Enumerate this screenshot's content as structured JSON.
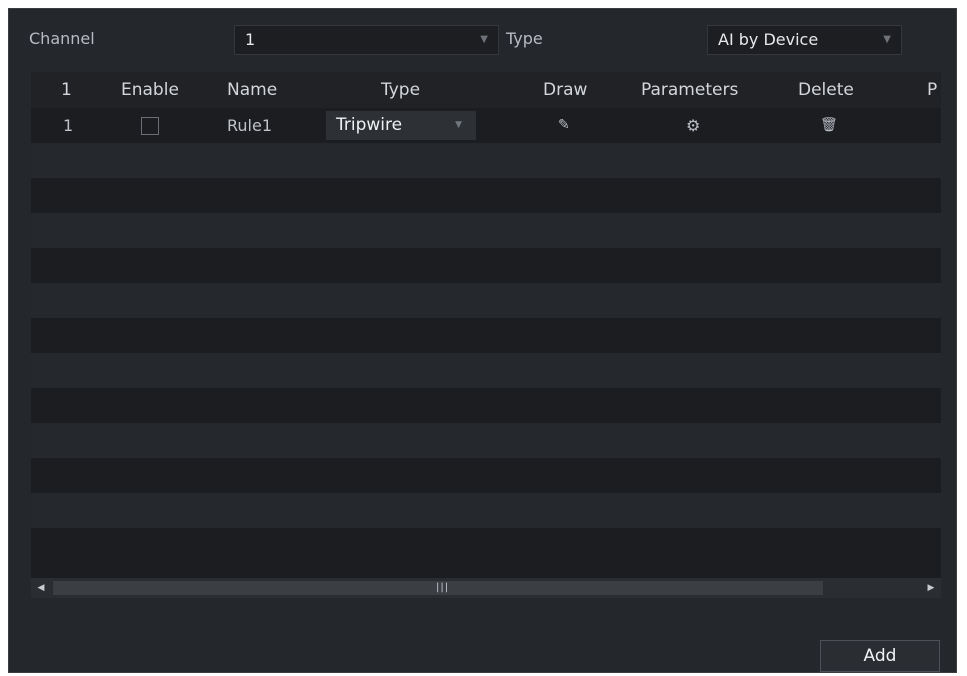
{
  "filters": {
    "channel_label": "Channel",
    "channel_value": "1",
    "type_label": "Type",
    "type_value": "AI by Device"
  },
  "table": {
    "headers": [
      "1",
      "Enable",
      "Name",
      "Type",
      "Draw",
      "Parameters",
      "Delete",
      "P"
    ],
    "rows": [
      {
        "index": "1",
        "enabled": false,
        "name": "Rule1",
        "type": "Tripwire",
        "draw_icon": "pencil-icon",
        "parameters_icon": "gear-icon",
        "delete_icon": "trash-icon"
      }
    ]
  },
  "footer": {
    "add_label": "Add"
  },
  "colors": {
    "panel_bg": "#24272c",
    "row_alt_bg": "#25282d",
    "row_bg": "#1b1d21"
  }
}
